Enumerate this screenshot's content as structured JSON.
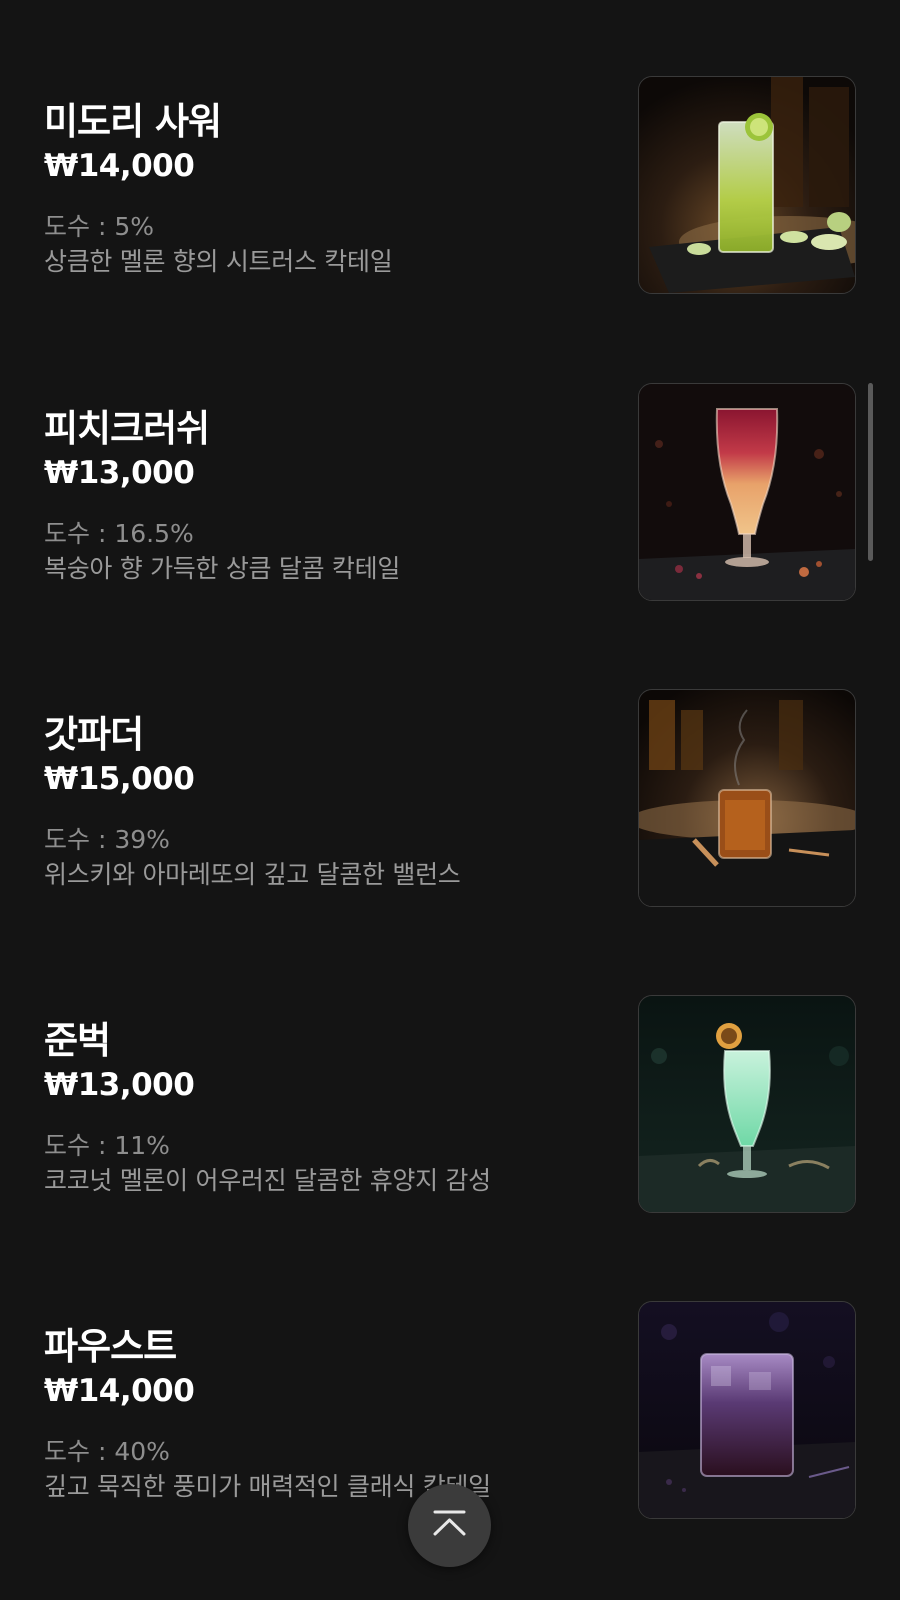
{
  "menu": {
    "items": [
      {
        "name": "미도리 사워",
        "price": "₩14,000",
        "abv": "도수 : 5%",
        "description": "상큼한 멜론 향의 시트러스 칵테일",
        "image": "midori-sour-cocktail-photo"
      },
      {
        "name": "피치크러쉬",
        "price": "₩13,000",
        "abv": "도수 : 16.5%",
        "description": "복숭아 향 가득한 상큼 달콤 칵테일",
        "image": "peach-crush-cocktail-photo"
      },
      {
        "name": "갓파더",
        "price": "₩15,000",
        "abv": "도수 : 39%",
        "description": "위스키와 아마레또의 깊고 달콤한 밸런스",
        "image": "godfather-cocktail-photo"
      },
      {
        "name": "준벅",
        "price": "₩13,000",
        "abv": "도수 : 11%",
        "description": "코코넛 멜론이 어우러진 달콤한 휴양지 감성",
        "image": "june-bug-cocktail-photo"
      },
      {
        "name": "파우스트",
        "price": "₩14,000",
        "abv": "도수 : 40%",
        "description": "깊고 묵직한 풍미가 매력적인 클래식 칵테일",
        "image": "faust-cocktail-photo"
      }
    ]
  },
  "scroll_top_button": {
    "icon": "chevron-up-to-top-icon"
  },
  "colors": {
    "background": "#141414",
    "name": "#ffffff",
    "meta_text": "#8e8e8e",
    "top_button": "#3b3b3b"
  }
}
